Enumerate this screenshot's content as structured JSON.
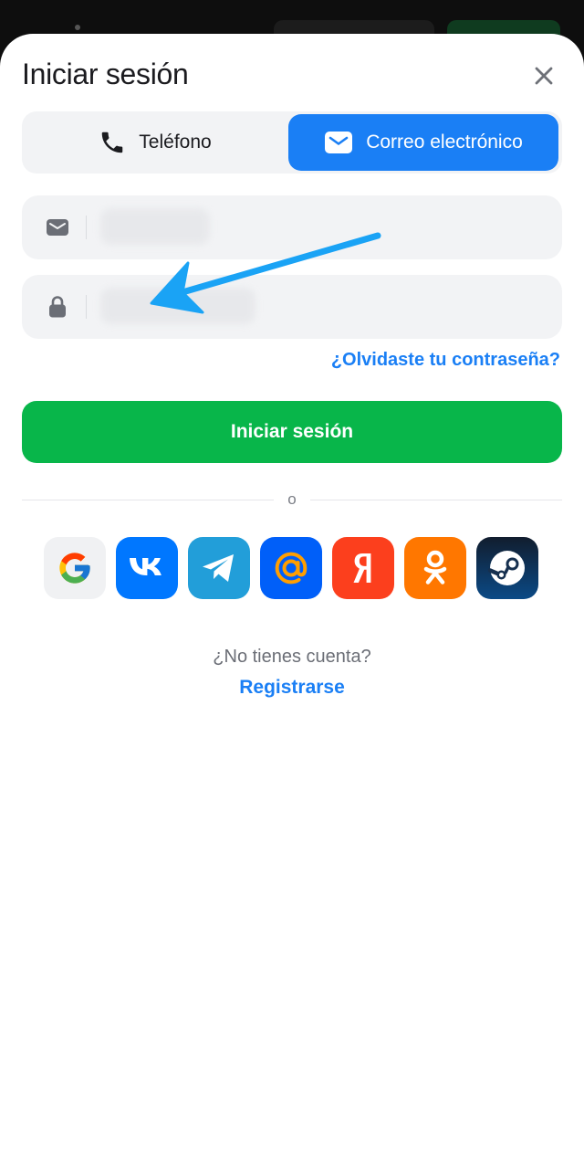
{
  "header": {
    "title": "Iniciar sesión"
  },
  "tabs": [
    {
      "label": "Teléfono",
      "icon": "phone-icon",
      "active": false
    },
    {
      "label": "Correo electrónico",
      "icon": "envelope-icon",
      "active": true
    }
  ],
  "fields": {
    "email": {
      "icon": "envelope-icon"
    },
    "password": {
      "icon": "lock-icon"
    }
  },
  "links": {
    "forgot_password": "¿Olvidaste tu contraseña?"
  },
  "primary_button": {
    "label": "Iniciar sesión"
  },
  "divider_text": "o",
  "social": [
    {
      "name": "Google",
      "icon": "google-icon",
      "color": "#f0f1f3"
    },
    {
      "name": "VK",
      "icon": "vk-icon",
      "color": "#0077ff"
    },
    {
      "name": "Telegram",
      "icon": "telegram-icon",
      "color": "#229ed9"
    },
    {
      "name": "Mail",
      "icon": "mail-at-icon",
      "color": "#005ff9"
    },
    {
      "name": "Yandex",
      "icon": "yandex-icon",
      "color": "#fc3f1d"
    },
    {
      "name": "Odnoklassniki",
      "icon": "ok-icon",
      "color": "#ff7700"
    },
    {
      "name": "Steam",
      "icon": "steam-icon",
      "color": "#1b2838"
    }
  ],
  "footer": {
    "no_account": "¿No tienes cuenta?",
    "register": "Registrarse"
  },
  "colors": {
    "accent": "#1a7ff5",
    "primary_green": "#08b64a",
    "annotation_arrow": "#1aa3f5"
  }
}
